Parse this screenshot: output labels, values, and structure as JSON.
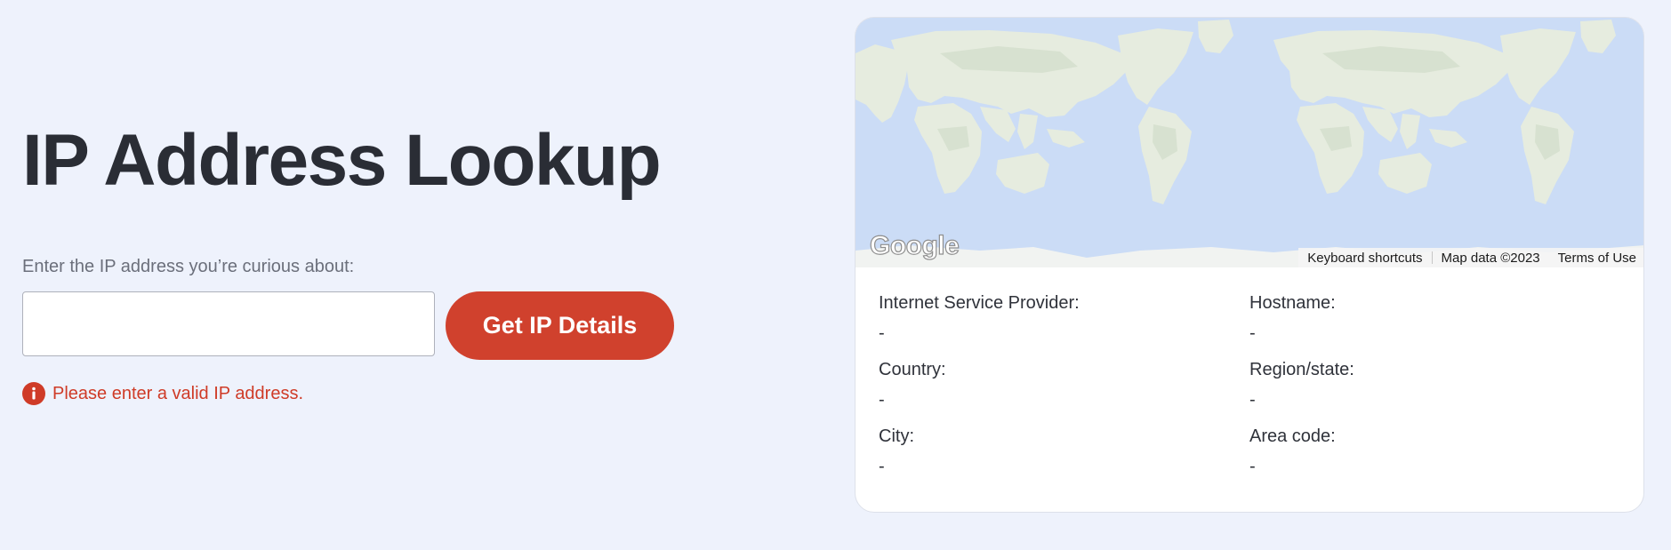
{
  "page": {
    "title": "IP Address Lookup"
  },
  "form": {
    "label": "Enter the IP address you’re curious about:",
    "input_value": "",
    "input_placeholder": "",
    "button_label": "Get IP Details",
    "error_message": "Please enter a valid IP address."
  },
  "map": {
    "logo_text": "Google",
    "footer": {
      "keyboard_shortcuts": "Keyboard shortcuts",
      "map_data": "Map data ©2023",
      "terms": "Terms of Use"
    }
  },
  "details": [
    {
      "label": "Internet Service Provider:",
      "value": "-"
    },
    {
      "label": "Hostname:",
      "value": "-"
    },
    {
      "label": "Country:",
      "value": "-"
    },
    {
      "label": "Region/state:",
      "value": "-"
    },
    {
      "label": "City:",
      "value": "-"
    },
    {
      "label": "Area code:",
      "value": "-"
    }
  ],
  "colors": {
    "page_background": "#eef2fc",
    "accent": "#d0412d",
    "error": "#cf3b27",
    "ocean": "#cbdcf6",
    "land": "#e6ecdf"
  },
  "icons": {
    "error": "info-circle-icon"
  }
}
